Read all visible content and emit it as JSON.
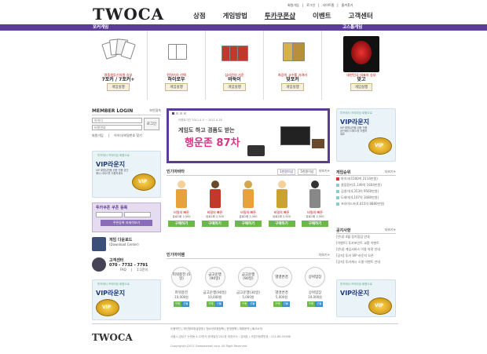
{
  "header": {
    "logo": "TWOCA",
    "toplinks": [
      "회원가입",
      "로그인",
      "사이트맵",
      "즐겨찾기"
    ],
    "nav": [
      "상점",
      "게임방법",
      "투카쿠폰샵",
      "이벤트",
      "고객센터"
    ]
  },
  "sections": {
    "poker": "포커게임",
    "gostop": "고스톱게임"
  },
  "games": [
    {
      "sub": "명품원투신의원 승부",
      "name": "7포커 / 7포커+",
      "btn": "게임실행"
    },
    {
      "sub": "전략가의 선택",
      "name": "하이로우",
      "btn": "게임실행"
    },
    {
      "sub": "심리전의 기준",
      "name": "바둑이",
      "btn": "게임실행"
    },
    {
      "sub": "최강의 고수를 가려라",
      "name": "맞포커",
      "btn": "게임실행"
    },
    {
      "sub": "대한민국 대표의 승부",
      "name": "맞고",
      "btn": "게임실행"
    }
  ],
  "login": {
    "title": "MEMBER LOGIN",
    "keep": "보안접속",
    "id_placeholder": "아이디",
    "pw_placeholder": "비밀번호",
    "login_btn": "로그인",
    "join": "회원가입",
    "find": "아이디/비밀번호 찾기"
  },
  "vip": {
    "small": "투카에서 프리미엄 회원으로",
    "title": "VIP라운지",
    "desc": "VIP 회원님만을 위한 전용 공간에서 서비스를 이용하세요"
  },
  "coupon": {
    "title": "투카쿠폰 쿠폰 등록",
    "btn": "쿠폰등록 자세히보기"
  },
  "download": {
    "title": "게임 다운로드",
    "sub": "(Download Center)"
  },
  "cs": {
    "title": "고객센터",
    "phone": "070 - 7732 - 7791",
    "faq": "FAQ",
    "qna": "1:1문의"
  },
  "banner": {
    "date": "이벤트기간 2011.4.5 ~ 2011.4.18",
    "line1": "게임도 하고 경품도 받는",
    "line2": "행운존 87차"
  },
  "popular_avatar": {
    "title": "인기아바타",
    "tabs": [
      "1천원이상",
      "5천원이상"
    ],
    "more": "더보기+",
    "items": [
      {
        "name": "비밀의 빠른",
        "price": "유료1회 2,500",
        "btn": "구매하기"
      },
      {
        "name": "비밀의 빠른",
        "price": "유료1회 2,500",
        "btn": "구매하기"
      },
      {
        "name": "비밀의 빠른",
        "price": "유료1회 2,500",
        "btn": "구매하기"
      },
      {
        "name": "비밀의 빠른",
        "price": "유료1회 2,500",
        "btn": "구매하기"
      },
      {
        "name": "비밀의 빠른",
        "price": "유료1회 2,500",
        "btn": "구매하기"
      }
    ]
  },
  "popular_item": {
    "title": "인기아이템",
    "more": "더보기+",
    "items": [
      {
        "circle": "피워충전 (5일)",
        "name": "파워충전",
        "price": "10,000원"
      },
      {
        "circle": "금고운행 (90일)",
        "name": "금고운행(90일)",
        "price": "10,000원"
      },
      {
        "circle": "금고운행 (90일)",
        "name": "금고운행(30일)",
        "price": "5,000원"
      },
      {
        "circle": "별명변경",
        "name": "별명변경",
        "price": "5,000원"
      },
      {
        "circle": "상위업장",
        "name": "상위업장",
        "price": "10,000원"
      }
    ],
    "btns": [
      "구매",
      "선물"
    ]
  },
  "ranking": {
    "title": "게임순위",
    "more": "더보기+",
    "rows": [
      "파이크(1500억 2114만원)",
      "클립원키(1,149억 1604만원)",
      "김영기(4,353억 9560만원)",
      "도레미(4,107억 3480만원)",
      "프라이드카(4,015억 8880만원)"
    ]
  },
  "notice": {
    "title": "공지사항",
    "more": "더보기+",
    "rows": [
      "[안내] 4월 정기점검 안내",
      "[이벤트] 투카포인트 교환 이벤트",
      "[안내] 게임서비스 이용 약관 안내",
      "[공지] 투카 VIP 라운지 오픈",
      "[공지] 투카캐시 소멸 이벤트 안내"
    ]
  },
  "footer": {
    "logo": "TWOCA",
    "links": "이용약관 | 개인정보취급방침 | 청소년보호정책 | 운영정책 | 제휴문의 | 회사소개",
    "addr": "서울시 강남구 논현동 4-22번지 한세빌딩 202호 대표이사 : 김태호 | 사업자등록번호 : 211-86-55566",
    "copy": "Copyright(c)2011 Gameaamall corp. All Right Reserved."
  },
  "colors": {
    "purple": "#5b3c98",
    "green": "#6cb84a"
  }
}
